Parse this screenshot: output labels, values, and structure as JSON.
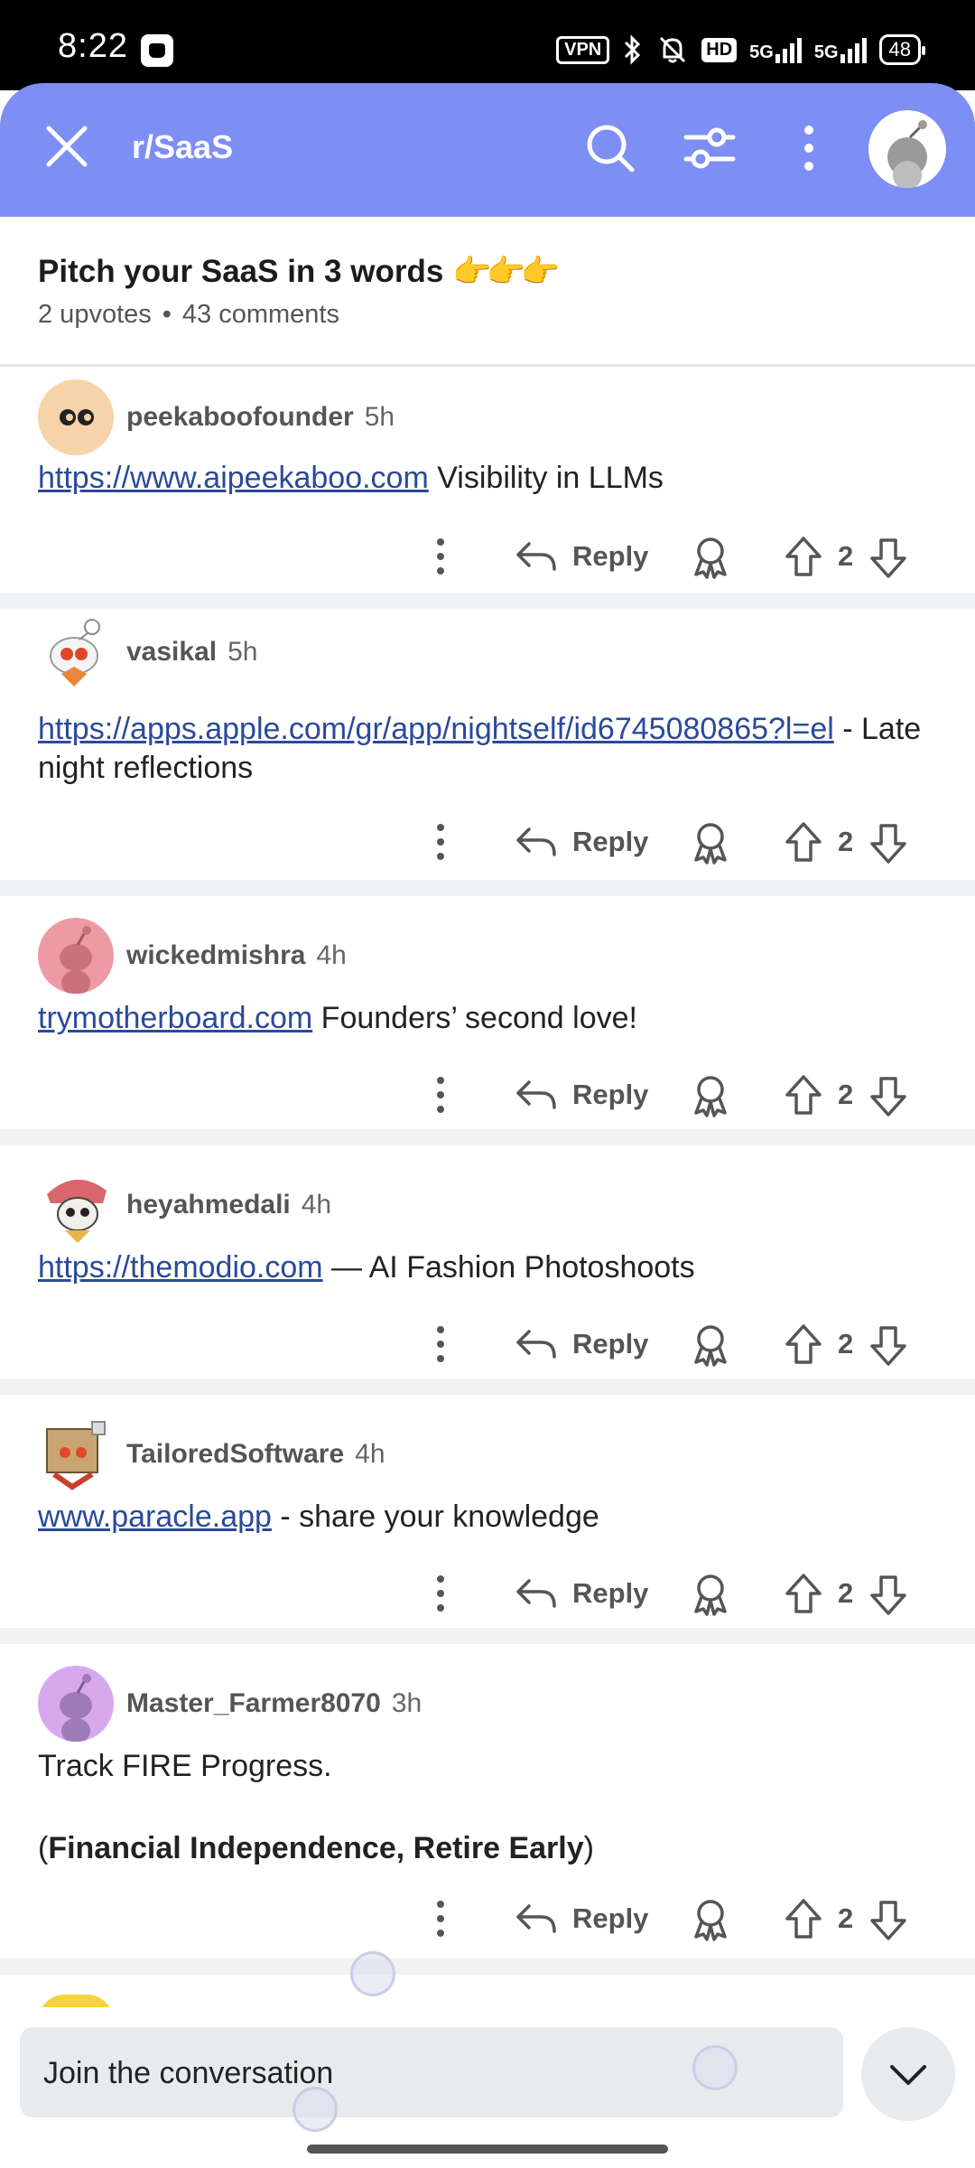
{
  "status_bar": {
    "time": "8:22",
    "vpn": "VPN",
    "hd": "HD",
    "net1": "5G",
    "net2": "5G",
    "battery": "48"
  },
  "header": {
    "title": "r/SaaS",
    "color": "#7d8ef5"
  },
  "post": {
    "title": "Pitch your SaaS in 3 words",
    "title_emoji": "👉👉👉",
    "upvotes": "2 upvotes",
    "separator": "•",
    "comments": "43 comments"
  },
  "comments": [
    {
      "user": "peekaboofounder",
      "time": "5h",
      "link": "https://www.aipeekaboo.com",
      "text": " Visibility in LLMs",
      "reply": "Reply",
      "score": "2"
    },
    {
      "user": "vasikal",
      "time": "5h",
      "link": "https://apps.apple.com/gr/app/nightself/id6745080865?l=el",
      "text": " - Late night reflections",
      "reply": "Reply",
      "score": "2"
    },
    {
      "user": "wickedmishra",
      "time": "4h",
      "link": "trymotherboard.com",
      "text": " Founders’ second love!",
      "reply": "Reply",
      "score": "2"
    },
    {
      "user": "heyahmedali",
      "time": "4h",
      "link": "https://themodio.com",
      "text": " — AI Fashion Photoshoots",
      "reply": "Reply",
      "score": "2"
    },
    {
      "user": "TailoredSoftware",
      "time": "4h",
      "link": "www.paracle.app",
      "text": " - share your knowledge",
      "reply": "Reply",
      "score": "2"
    },
    {
      "user": "Master_Farmer8070",
      "time": "3h",
      "line1": "Track FIRE Progress.",
      "line2_open": "(",
      "line2_bold": "Financial Independence, Retire Early",
      "line2_close": ")",
      "reply": "Reply",
      "score": "2"
    }
  ],
  "composer": {
    "placeholder": "Join the conversation"
  },
  "icons": {
    "close": "close-icon",
    "search": "search-icon",
    "filter": "filter-icon",
    "more": "more-vertical-icon",
    "reply": "reply-arrow-icon",
    "award": "award-icon",
    "upvote": "upvote-arrow-icon",
    "downvote": "downvote-arrow-icon",
    "collapse": "chevron-down-icon"
  }
}
